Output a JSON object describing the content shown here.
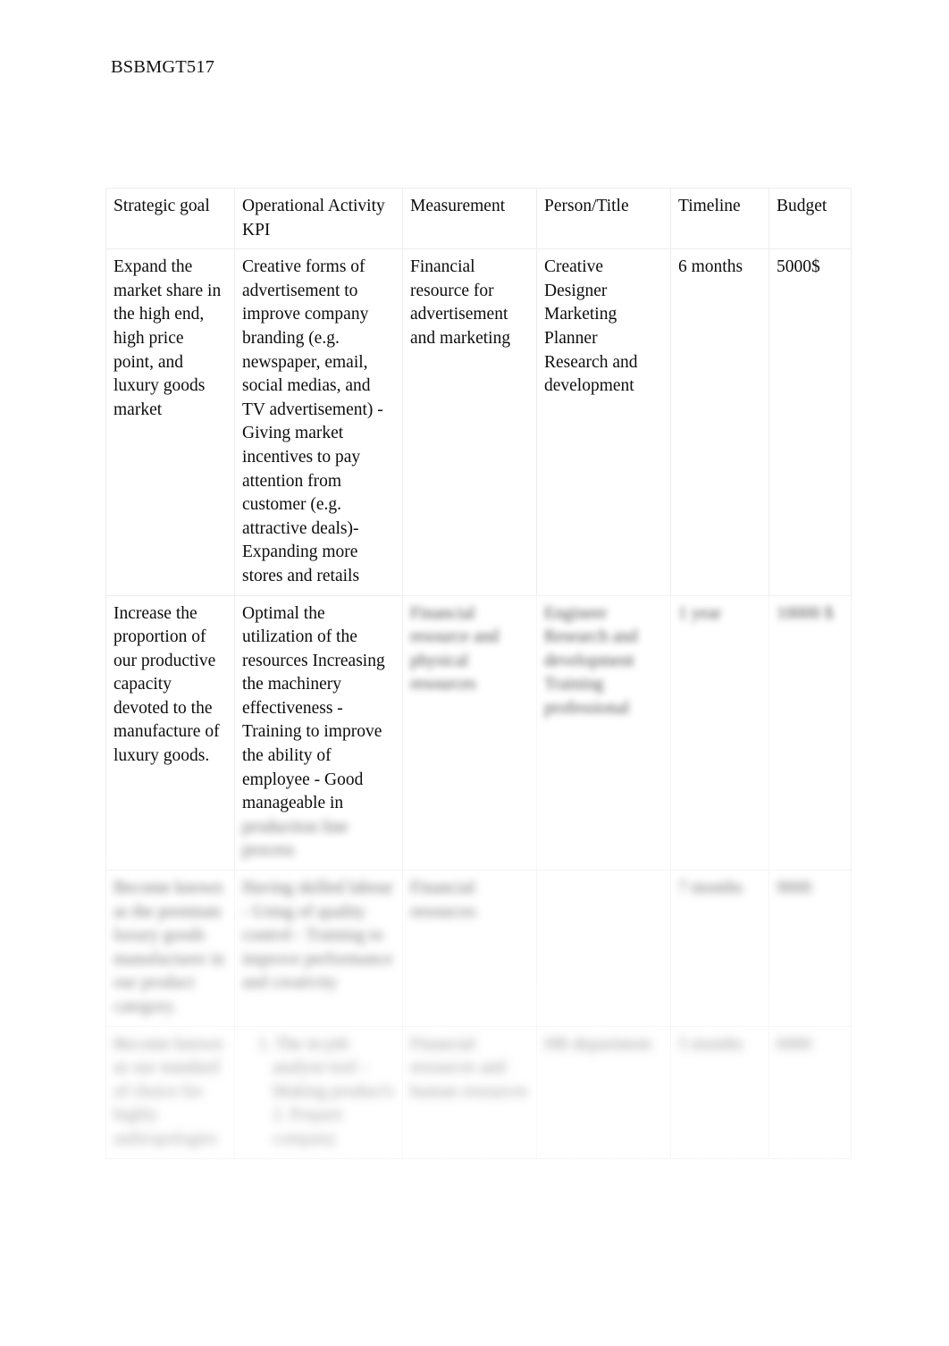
{
  "document": {
    "header_text": "BSBMGT517",
    "page_background": "#ffffff",
    "text_color": "#0d0d0d",
    "border_color": "#ededed"
  },
  "table": {
    "name": "operational-plan-kpi-table",
    "columns": [
      {
        "key": "strategic_goal",
        "label": "Strategic goal"
      },
      {
        "key": "operational_activity",
        "label": "Operational Activity KPI"
      },
      {
        "key": "measurement",
        "label": "Measurement"
      },
      {
        "key": "person_title",
        "label": "Person/Title"
      },
      {
        "key": "timeline",
        "label": "Timeline"
      },
      {
        "key": "budget",
        "label": "Budget"
      }
    ],
    "rows": [
      {
        "legibility": "sharp",
        "strategic_goal": "Expand the market share in the high end, high price point, and luxury goods market",
        "operational_activity": "Creative forms of advertisement to improve company branding (e.g. newspaper, email, social medias, and TV advertisement) - Giving market incentives to pay attention from customer (e.g. attractive deals)- Expanding more stores and retails",
        "measurement": "Financial resource for advertisement and marketing",
        "person_title": "Creative Designer Marketing Planner Research and development",
        "timeline": "6 months",
        "budget": "5000$"
      },
      {
        "legibility": "partially-blurred",
        "strategic_goal": "Increase the proportion of our productive capacity devoted to the manufacture of luxury goods.",
        "operational_activity": "Optimal the utilization of the resources Increasing the machinery effectiveness - Training to improve the ability of employee - Good manageable in",
        "operational_activity_blurred_tail": "production line process",
        "measurement": "Financial resource and physical resources",
        "person_title": "Engineer Research and development Training professional",
        "timeline": "1 year",
        "budget": "10000 $"
      },
      {
        "legibility": "blurred",
        "strategic_goal": "Become known as the premium luxury goods manufacturer in our product category.",
        "operational_activity": "Having skilled labour - Using of quality control - Training to improve performance and creativity",
        "measurement": "Financial resources",
        "person_title": "",
        "timeline": "7 months",
        "budget": "9000"
      },
      {
        "legibility": "blurred",
        "strategic_goal": "Become known as our standard of choice for highly anthropologies",
        "operational_activity": "1. The in-job analyse tool - Making product's 2. Prepare company",
        "measurement": "Financial resources and human resources",
        "person_title": "HR department",
        "timeline": "5 months",
        "budget": "6000"
      }
    ]
  }
}
